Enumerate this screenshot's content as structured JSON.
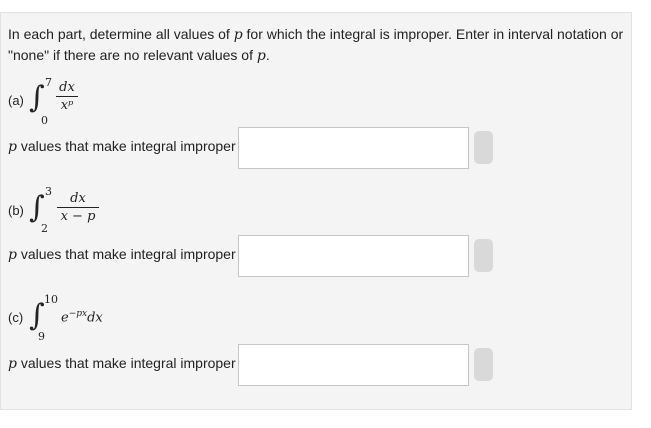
{
  "instructions": {
    "before_p1": "In each part, determine all values of ",
    "p1": "p",
    "after_p1": " for which the integral is improper. Enter in interval notation or \"none\" if there are no relevant values of ",
    "p2": "p",
    "after_p2": "."
  },
  "parts": [
    {
      "label": "(a)",
      "lower": "0",
      "upper": "7",
      "numerator": "dx",
      "denominator": "xᵖ",
      "prompt_var": "p",
      "prompt_text": " values that make integral improper",
      "answer_value": ""
    },
    {
      "label": "(b)",
      "lower": "2",
      "upper": "3",
      "numerator": "dx",
      "denominator": "x − p",
      "prompt_var": "p",
      "prompt_text": " values that make integral improper",
      "answer_value": ""
    },
    {
      "label": "(c)",
      "lower": "9",
      "upper": "10",
      "integrand_base": "e",
      "integrand_exp": "−px",
      "integrand_dx": "dx",
      "prompt_var": "p",
      "prompt_text": " values that make integral improper",
      "answer_value": ""
    }
  ]
}
